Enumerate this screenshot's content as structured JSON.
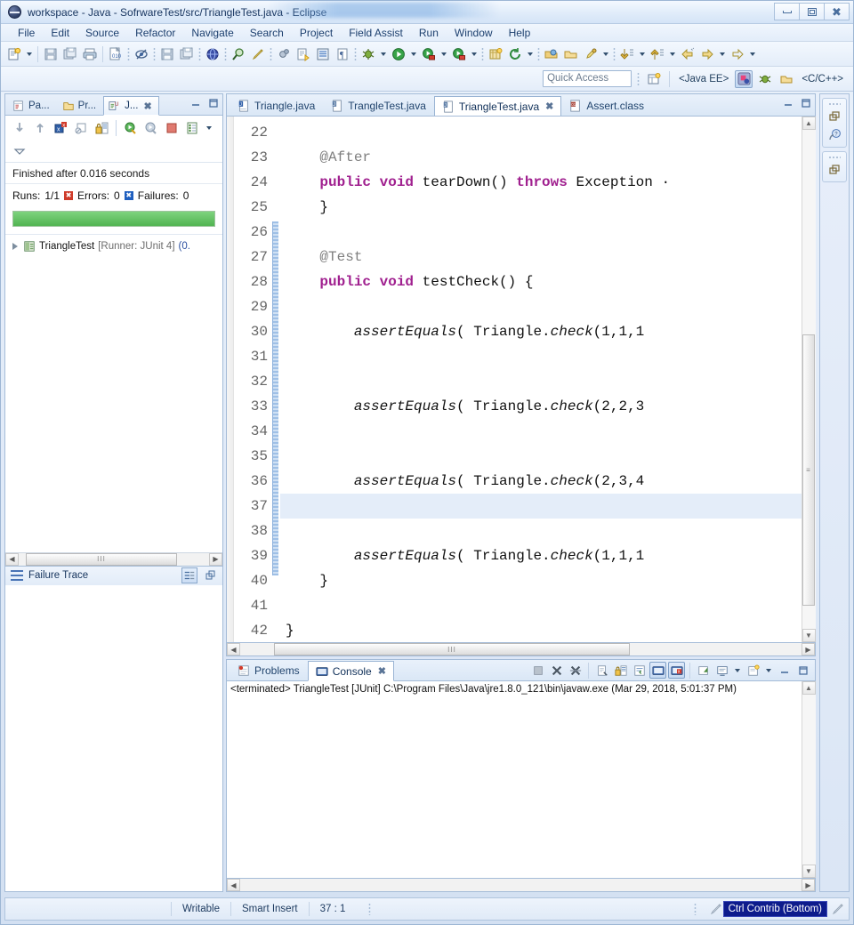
{
  "window": {
    "title": "workspace - Java - SofrwareTest/src/TriangleTest.java - Eclipse",
    "minimize_label": "Minimize",
    "maximize_label": "Maximize",
    "close_label": "Close"
  },
  "menu": {
    "items": [
      "File",
      "Edit",
      "Source",
      "Refactor",
      "Navigate",
      "Search",
      "Project",
      "Field Assist",
      "Run",
      "Window",
      "Help"
    ]
  },
  "toolbar": {
    "quick_access_placeholder": "Quick Access",
    "perspective_java_ee": "<Java EE>",
    "perspective_cpp": "<C/C++>",
    "icons": [
      "new-wizard-icon",
      "save-icon",
      "save-all-icon",
      "print-icon",
      "new-java-class-icon",
      "toggle-mark-occurrences-icon",
      "save-2-icon",
      "save-all-2-icon",
      "globe-icon",
      "search-icon",
      "pencil-icon",
      "skip-breakpoints-icon",
      "external-tools-icon",
      "java-browsing-icon",
      "pilcrow-icon",
      "debug-icon",
      "run-icon",
      "run-as-icon",
      "coverage-icon",
      "new-java-package-icon",
      "refresh-icon",
      "open-type-icon",
      "open-folder-icon",
      "link-icon",
      "previous-annotation-icon",
      "next-annotation-icon",
      "back-icon",
      "forward-icon"
    ]
  },
  "junit_view": {
    "tabs": [
      {
        "label": "Pa...",
        "icon": "package-explorer-icon",
        "active": false
      },
      {
        "label": "Pr...",
        "icon": "project-explorer-icon",
        "active": false
      },
      {
        "label": "J...",
        "icon": "junit-icon",
        "active": true
      }
    ],
    "toolbar_icons": [
      "next-failure-icon",
      "previous-failure-icon",
      "show-failures-only-icon",
      "show-skipped-icon",
      "scroll-lock-icon",
      "rerun-test-icon",
      "rerun-failed-icon",
      "stop-icon",
      "test-run-history-icon",
      "view-menu-icon"
    ],
    "status": "Finished after 0.016 seconds",
    "runs_label": "Runs:",
    "runs_value": "1/1",
    "errors_label": "Errors:",
    "errors_value": "0",
    "failures_label": "Failures:",
    "failures_value": "0",
    "progress_color": "#51b451",
    "progress_percent": 100,
    "tree": [
      {
        "name": "TriangleTest",
        "detail": "[Runner: JUnit 4]",
        "time": "(0."
      }
    ],
    "failure_trace_label": "Failure Trace",
    "failure_trace_icons": [
      "filter-stack-trace-icon",
      "maximize-icon"
    ]
  },
  "editor": {
    "tabs": [
      {
        "label": "Triangle.java",
        "icon": "java-file-icon",
        "active": false,
        "closeable": false
      },
      {
        "label": "TrangleTest.java",
        "icon": "java-file-icon",
        "active": false,
        "closeable": false
      },
      {
        "label": "TriangleTest.java",
        "icon": "java-file-icon",
        "active": true,
        "closeable": true
      },
      {
        "label": "Assert.class",
        "icon": "class-file-icon",
        "active": false,
        "closeable": false
      }
    ],
    "first_line": 22,
    "current_line": 37,
    "lines": [
      {
        "n": 22,
        "fold": false,
        "tokens": []
      },
      {
        "n": 23,
        "fold": true,
        "tokens": [
          {
            "t": "    ",
            "c": "plain"
          },
          {
            "t": "@After",
            "c": "ann"
          }
        ]
      },
      {
        "n": 24,
        "fold": false,
        "tokens": [
          {
            "t": "    ",
            "c": "plain"
          },
          {
            "t": "public",
            "c": "kw"
          },
          {
            "t": " ",
            "c": "plain"
          },
          {
            "t": "void",
            "c": "kw"
          },
          {
            "t": " tearDown() ",
            "c": "plain"
          },
          {
            "t": "throws",
            "c": "kw"
          },
          {
            "t": " Exception ",
            "c": "plain"
          },
          {
            "t": "·",
            "c": "plain"
          }
        ]
      },
      {
        "n": 25,
        "fold": false,
        "tokens": [
          {
            "t": "    }",
            "c": "plain"
          }
        ]
      },
      {
        "n": 26,
        "fold": false,
        "tokens": []
      },
      {
        "n": 27,
        "fold": true,
        "tokens": [
          {
            "t": "    ",
            "c": "plain"
          },
          {
            "t": "@Test",
            "c": "ann"
          }
        ]
      },
      {
        "n": 28,
        "fold": false,
        "tokens": [
          {
            "t": "    ",
            "c": "plain"
          },
          {
            "t": "public",
            "c": "kw"
          },
          {
            "t": " ",
            "c": "plain"
          },
          {
            "t": "void",
            "c": "kw"
          },
          {
            "t": " testCheck() {",
            "c": "plain"
          }
        ]
      },
      {
        "n": 29,
        "fold": false,
        "tokens": []
      },
      {
        "n": 30,
        "fold": false,
        "tokens": [
          {
            "t": "        ",
            "c": "plain"
          },
          {
            "t": "assertEquals",
            "c": "meth"
          },
          {
            "t": "( Triangle.",
            "c": "plain"
          },
          {
            "t": "check",
            "c": "meth"
          },
          {
            "t": "(1,1,1",
            "c": "plain"
          }
        ]
      },
      {
        "n": 31,
        "fold": false,
        "tokens": []
      },
      {
        "n": 32,
        "fold": false,
        "tokens": []
      },
      {
        "n": 33,
        "fold": false,
        "tokens": [
          {
            "t": "        ",
            "c": "plain"
          },
          {
            "t": "assertEquals",
            "c": "meth"
          },
          {
            "t": "( Triangle.",
            "c": "plain"
          },
          {
            "t": "check",
            "c": "meth"
          },
          {
            "t": "(2,2,3",
            "c": "plain"
          }
        ]
      },
      {
        "n": 34,
        "fold": false,
        "tokens": []
      },
      {
        "n": 35,
        "fold": false,
        "tokens": []
      },
      {
        "n": 36,
        "fold": false,
        "tokens": [
          {
            "t": "        ",
            "c": "plain"
          },
          {
            "t": "assertEquals",
            "c": "meth"
          },
          {
            "t": "( Triangle.",
            "c": "plain"
          },
          {
            "t": "check",
            "c": "meth"
          },
          {
            "t": "(2,3,4",
            "c": "plain"
          }
        ]
      },
      {
        "n": 37,
        "fold": false,
        "tokens": []
      },
      {
        "n": 38,
        "fold": false,
        "tokens": []
      },
      {
        "n": 39,
        "fold": false,
        "tokens": [
          {
            "t": "        ",
            "c": "plain"
          },
          {
            "t": "assertEquals",
            "c": "meth"
          },
          {
            "t": "( Triangle.",
            "c": "plain"
          },
          {
            "t": "check",
            "c": "meth"
          },
          {
            "t": "(1,1,1",
            "c": "plain"
          }
        ]
      },
      {
        "n": 40,
        "fold": false,
        "tokens": [
          {
            "t": "    }",
            "c": "plain"
          }
        ]
      },
      {
        "n": 41,
        "fold": false,
        "tokens": []
      },
      {
        "n": 42,
        "fold": false,
        "tokens": [
          {
            "t": "}",
            "c": "plain"
          }
        ]
      }
    ]
  },
  "console": {
    "tabs": [
      {
        "label": "Problems",
        "icon": "problems-icon",
        "active": false,
        "closeable": false
      },
      {
        "label": "Console",
        "icon": "console-icon",
        "active": true,
        "closeable": true
      }
    ],
    "toolbar_icons": [
      "terminate-icon",
      "remove-launch-icon",
      "remove-all-terminated-icon",
      "clear-console-icon",
      "scroll-lock-icon",
      "word-wrap-icon",
      "show-console-on-output-icon",
      "show-console-on-error-icon",
      "pin-console-icon",
      "display-selected-console-icon",
      "open-console-icon",
      "minimize-icon",
      "maximize-icon"
    ],
    "output": "<terminated> TriangleTest [JUnit] C:\\Program Files\\Java\\jre1.8.0_121\\bin\\javaw.exe (Mar 29, 2018, 5:01:37 PM)"
  },
  "fastview": {
    "buttons": [
      "restore-icon",
      "help-view-icon",
      "restore-2-icon"
    ]
  },
  "statusbar": {
    "writable": "Writable",
    "insert_mode": "Smart Insert",
    "position": "37 : 1",
    "contrib_badge": "Ctrl Contrib (Bottom)"
  }
}
